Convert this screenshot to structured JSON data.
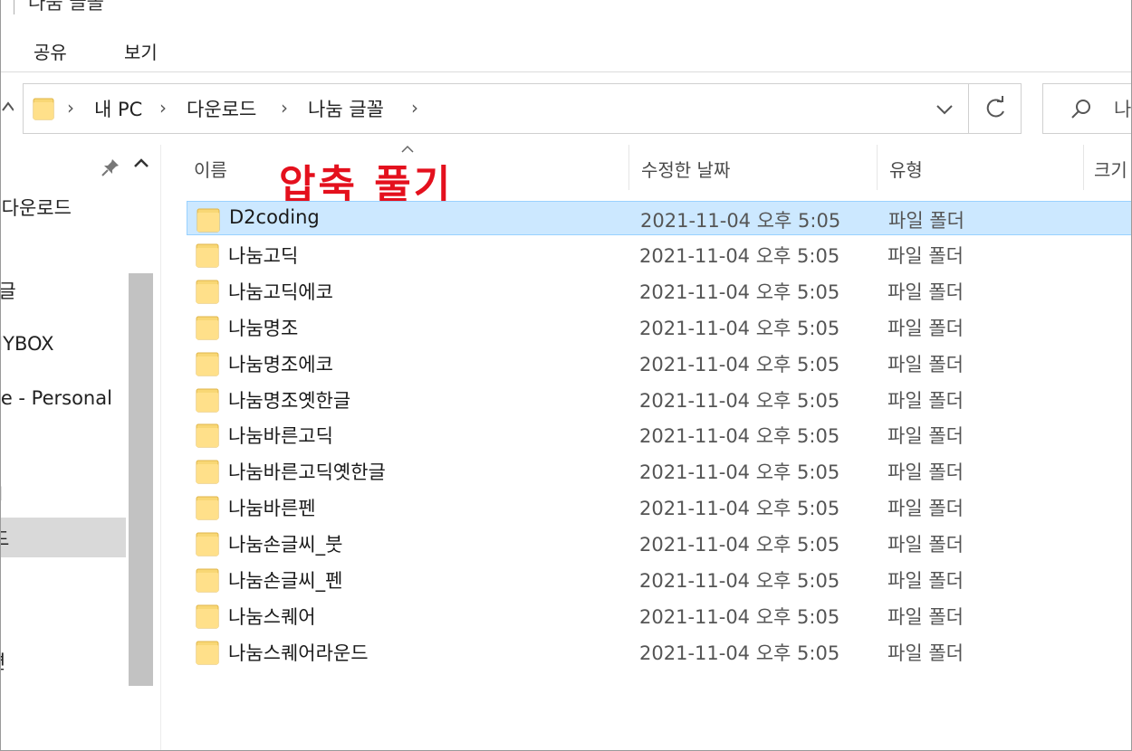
{
  "window": {
    "title": "나눔 글꼴"
  },
  "ribbon": {
    "tabs": [
      "공유",
      "보기"
    ]
  },
  "address": {
    "breadcrumbs": [
      "내 PC",
      "다운로드",
      "나눔 글꼴"
    ],
    "search_text": "나"
  },
  "sidebar": {
    "items": [
      "컴퓨터 다운로드",
      "구글",
      "MYBOX",
      "OneDrive - Personal",
      "Ι",
      "드",
      "면"
    ]
  },
  "columns": {
    "name": "이름",
    "modified": "수정한 날짜",
    "type": "유형",
    "size": "크기"
  },
  "annotation": "압축 풀기",
  "files": [
    {
      "name": "D2coding",
      "modified": "2021-11-04 오후 5:05",
      "type": "파일 폴더"
    },
    {
      "name": "나눔고딕",
      "modified": "2021-11-04 오후 5:05",
      "type": "파일 폴더"
    },
    {
      "name": "나눔고딕에코",
      "modified": "2021-11-04 오후 5:05",
      "type": "파일 폴더"
    },
    {
      "name": "나눔명조",
      "modified": "2021-11-04 오후 5:05",
      "type": "파일 폴더"
    },
    {
      "name": "나눔명조에코",
      "modified": "2021-11-04 오후 5:05",
      "type": "파일 폴더"
    },
    {
      "name": "나눔명조옛한글",
      "modified": "2021-11-04 오후 5:05",
      "type": "파일 폴더"
    },
    {
      "name": "나눔바른고딕",
      "modified": "2021-11-04 오후 5:05",
      "type": "파일 폴더"
    },
    {
      "name": "나눔바른고딕옛한글",
      "modified": "2021-11-04 오후 5:05",
      "type": "파일 폴더"
    },
    {
      "name": "나눔바른펜",
      "modified": "2021-11-04 오후 5:05",
      "type": "파일 폴더"
    },
    {
      "name": "나눔손글씨_붓",
      "modified": "2021-11-04 오후 5:05",
      "type": "파일 폴더"
    },
    {
      "name": "나눔손글씨_펜",
      "modified": "2021-11-04 오후 5:05",
      "type": "파일 폴더"
    },
    {
      "name": "나눔스퀘어",
      "modified": "2021-11-04 오후 5:05",
      "type": "파일 폴더"
    },
    {
      "name": "나눔스퀘어라운드",
      "modified": "2021-11-04 오후 5:05",
      "type": "파일 폴더"
    }
  ],
  "colors": {
    "selection": "#cce8ff",
    "selection_border": "#99d1ff",
    "annotation": "#e4101d",
    "folder": "#f8d775"
  }
}
